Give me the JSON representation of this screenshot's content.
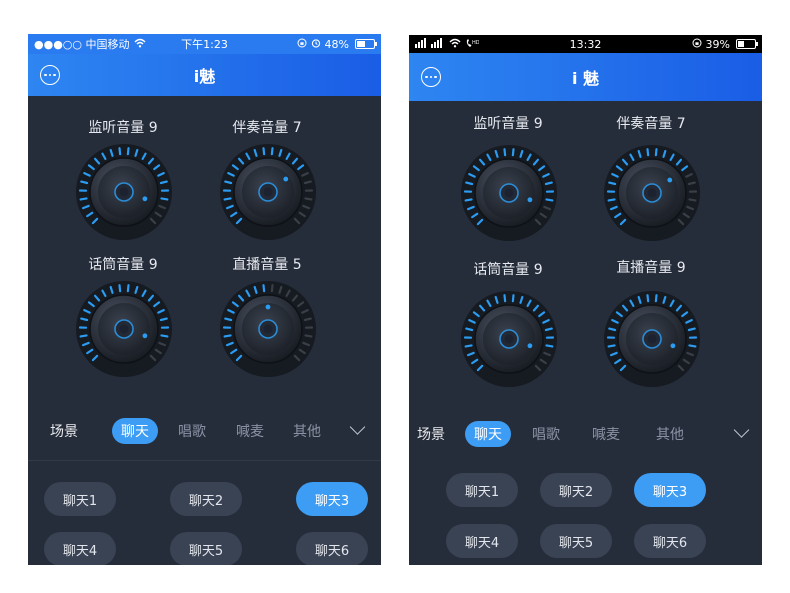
{
  "colors": {
    "accent": "#3d9df4",
    "header": "#2a7bf0",
    "background": "#262d3a"
  },
  "left": {
    "status": {
      "carrier": "●●●○○ 中国移动",
      "time": "下午1:23",
      "battery": "48%",
      "battery_level": 0.48
    },
    "header": {
      "title": "i魅"
    },
    "knobs": [
      {
        "label": "监听音量  9",
        "value": 9
      },
      {
        "label": "伴奏音量  7",
        "value": 7
      },
      {
        "label": "话筒音量  9",
        "value": 9
      },
      {
        "label": "直播音量  5",
        "value": 5
      }
    ],
    "scene": {
      "title": "场景",
      "tabs": [
        "聊天",
        "唱歌",
        "喊麦",
        "其他"
      ],
      "active_index": 0
    },
    "presets": [
      "聊天1",
      "聊天2",
      "聊天3",
      "聊天4",
      "聊天5",
      "聊天6"
    ],
    "active_preset_index": 2
  },
  "right": {
    "status": {
      "signal": "ᵢll ᵢll",
      "time": "13:32",
      "battery": "39%",
      "battery_level": 0.39
    },
    "header": {
      "title": "i 魅"
    },
    "knobs": [
      {
        "label": "监听音量 9",
        "value": 9
      },
      {
        "label": "伴奏音量 7",
        "value": 7
      },
      {
        "label": "话筒音量 9",
        "value": 9
      },
      {
        "label": "直播音量 9",
        "value": 9
      }
    ],
    "scene": {
      "title": "场景",
      "tabs": [
        "聊天",
        "唱歌",
        "喊麦",
        "其他"
      ],
      "active_index": 0
    },
    "presets": [
      "聊天1",
      "聊天2",
      "聊天3",
      "聊天4",
      "聊天5",
      "聊天6"
    ],
    "active_preset_index": 2
  },
  "knob_max": 10
}
